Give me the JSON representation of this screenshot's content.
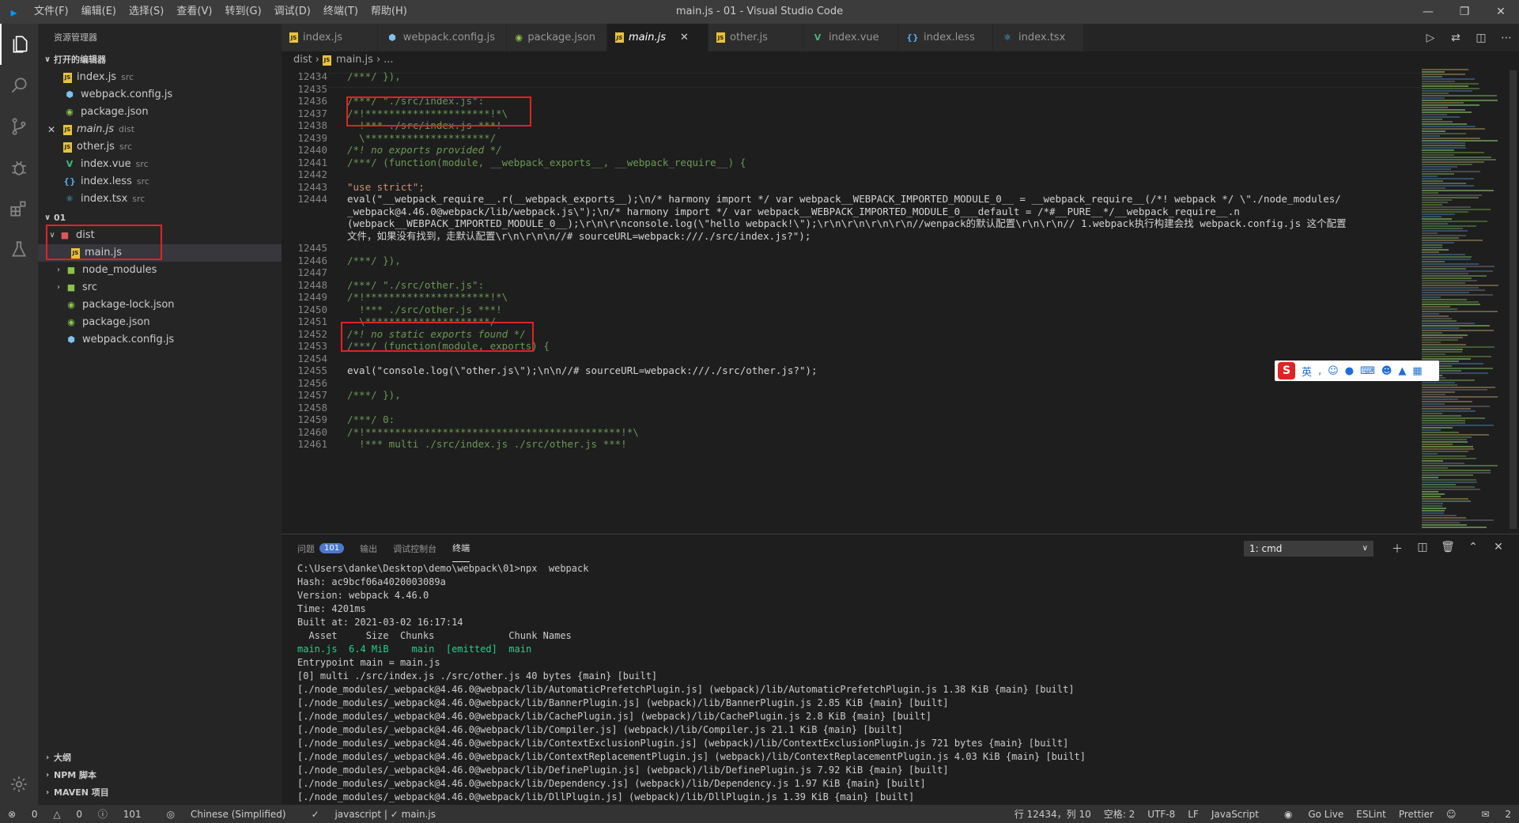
{
  "window": {
    "title": "main.js - 01 - Visual Studio Code",
    "menu": [
      "文件(F)",
      "编辑(E)",
      "选择(S)",
      "查看(V)",
      "转到(G)",
      "调试(D)",
      "终端(T)",
      "帮助(H)"
    ]
  },
  "sidebar": {
    "header": "资源管理器",
    "open_editors_title": "打开的编辑器",
    "open_editors": [
      {
        "name": "index.js",
        "desc": "src"
      },
      {
        "name": "webpack.config.js",
        "desc": ""
      },
      {
        "name": "package.json",
        "desc": ""
      },
      {
        "name": "main.js",
        "desc": "dist"
      },
      {
        "name": "other.js",
        "desc": "src"
      },
      {
        "name": "index.vue",
        "desc": "src"
      },
      {
        "name": "index.less",
        "desc": "src"
      },
      {
        "name": "index.tsx",
        "desc": "src"
      }
    ],
    "workspace_title": "01",
    "tree": [
      {
        "name": "dist"
      },
      {
        "name": "main.js"
      },
      {
        "name": "node_modules"
      },
      {
        "name": "src"
      },
      {
        "name": "package-lock.json"
      },
      {
        "name": "package.json"
      },
      {
        "name": "webpack.config.js"
      }
    ],
    "bottom_sections": [
      "大纲",
      "NPM 脚本",
      "MAVEN 项目"
    ]
  },
  "tabs": [
    {
      "label": "index.js"
    },
    {
      "label": "webpack.config.js"
    },
    {
      "label": "package.json"
    },
    {
      "label": "main.js"
    },
    {
      "label": "other.js"
    },
    {
      "label": "index.vue"
    },
    {
      "label": "index.less"
    },
    {
      "label": "index.tsx"
    }
  ],
  "breadcrumb": {
    "folder": "dist",
    "file": "main.js",
    "more": "..."
  },
  "editor": {
    "line_numbers": [
      "12434",
      "12435",
      "12436",
      "12437",
      "12438",
      "12439",
      "12440",
      "12441",
      "12442",
      "12443",
      "12444",
      "",
      "",
      "",
      "12445",
      "12446",
      "12447",
      "12448",
      "12449",
      "12450",
      "12451",
      "12452",
      "12453",
      "12454",
      "12455",
      "12456",
      "12457",
      "12458",
      "12459",
      "12460",
      "12461"
    ],
    "lines": [
      "/***/ }),",
      "",
      "/***/ \"./src/index.js\":",
      "/*!*********************!*\\",
      "  !*** ./src/index.js ***!",
      "  \\*********************/",
      "/*! no exports provided */",
      "/***/ (function(module, __webpack_exports__, __webpack_require__) {",
      "",
      "\"use strict\";",
      "eval(\"__webpack_require__.r(__webpack_exports__);\\n/* harmony import */ var webpack__WEBPACK_IMPORTED_MODULE_0__ = __webpack_require__(/*! webpack */ \\\"./node_modules/",
      "_webpack@4.46.0@webpack/lib/webpack.js\\\");\\n/* harmony import */ var webpack__WEBPACK_IMPORTED_MODULE_0___default = /*#__PURE__*/__webpack_require__.n",
      "(webpack__WEBPACK_IMPORTED_MODULE_0__);\\r\\n\\r\\nconsole.log(\\\"hello webpack!\\\");\\r\\n\\r\\n\\r\\n\\r\\n//wenpack的默认配置\\r\\n\\r\\n// 1.webpack执行构建会找 webpack.config.js 这个配置",
      "文件，如果没有找到，走默认配置\\r\\n\\r\\n\\n//# sourceURL=webpack:///./src/index.js?\");",
      "",
      "/***/ }),",
      "",
      "/***/ \"./src/other.js\":",
      "/*!*********************!*\\",
      "  !*** ./src/other.js ***!",
      "  \\*********************/",
      "/*! no static exports found */",
      "/***/ (function(module, exports) {",
      "",
      "eval(\"console.log(\\\"other.js\\\");\\n\\n//# sourceURL=webpack:///./src/other.js?\");",
      "",
      "/***/ }),",
      "",
      "/***/ 0:",
      "/*!*******************************************!*\\",
      "  !*** multi ./src/index.js ./src/other.js ***!"
    ]
  },
  "panel": {
    "tabs": [
      "问题",
      "输出",
      "调试控制台",
      "终端"
    ],
    "problems_count": "101",
    "terminal_select": "1: cmd",
    "terminal_lines": [
      "C:\\Users\\danke\\Desktop\\demo\\webpack\\01>npx  webpack",
      "Hash: ac9bcf06a4020003089a",
      "Version: webpack 4.46.0",
      "Time: 4201ms",
      "Built at: 2021-03-02 16:17:14",
      "  Asset     Size  Chunks             Chunk Names",
      "main.js  6.4 MiB    main  [emitted]  main",
      "Entrypoint main = main.js",
      "[0] multi ./src/index.js ./src/other.js 40 bytes {main} [built]",
      "[./node_modules/_webpack@4.46.0@webpack/lib/AutomaticPrefetchPlugin.js] (webpack)/lib/AutomaticPrefetchPlugin.js 1.38 KiB {main} [built]",
      "[./node_modules/_webpack@4.46.0@webpack/lib/BannerPlugin.js] (webpack)/lib/BannerPlugin.js 2.85 KiB {main} [built]",
      "[./node_modules/_webpack@4.46.0@webpack/lib/CachePlugin.js] (webpack)/lib/CachePlugin.js 2.8 KiB {main} [built]",
      "[./node_modules/_webpack@4.46.0@webpack/lib/Compiler.js] (webpack)/lib/Compiler.js 21.1 KiB {main} [built]",
      "[./node_modules/_webpack@4.46.0@webpack/lib/ContextExclusionPlugin.js] (webpack)/lib/ContextExclusionPlugin.js 721 bytes {main} [built]",
      "[./node_modules/_webpack@4.46.0@webpack/lib/ContextReplacementPlugin.js] (webpack)/lib/ContextReplacementPlugin.js 4.03 KiB {main} [built]",
      "[./node_modules/_webpack@4.46.0@webpack/lib/DefinePlugin.js] (webpack)/lib/DefinePlugin.js 7.92 KiB {main} [built]",
      "[./node_modules/_webpack@4.46.0@webpack/lib/Dependency.js] (webpack)/lib/Dependency.js 1.97 KiB {main} [built]",
      "[./node_modules/_webpack@4.46.0@webpack/lib/DllPlugin.js] (webpack)/lib/DllPlugin.js 1.39 KiB {main} [built]"
    ]
  },
  "statusbar": {
    "errors": "0",
    "warnings": "0",
    "info": "101",
    "language_pack": "Chinese (Simplified)",
    "lint_status": "javascript | ✓ main.js",
    "cursor": "行 12434，列 10",
    "indent": "空格: 2",
    "encoding": "UTF-8",
    "eol": "LF",
    "language": "JavaScript",
    "golive": "Go Live",
    "eslint": "ESLint",
    "prettier": "Prettier",
    "notifications": "2"
  },
  "ime": {
    "label": "英"
  },
  "colors": {
    "accent": "#007acc",
    "highlight_box": "#e02323",
    "editor_bg": "#1e1e1e",
    "sidebar_bg": "#252526"
  }
}
